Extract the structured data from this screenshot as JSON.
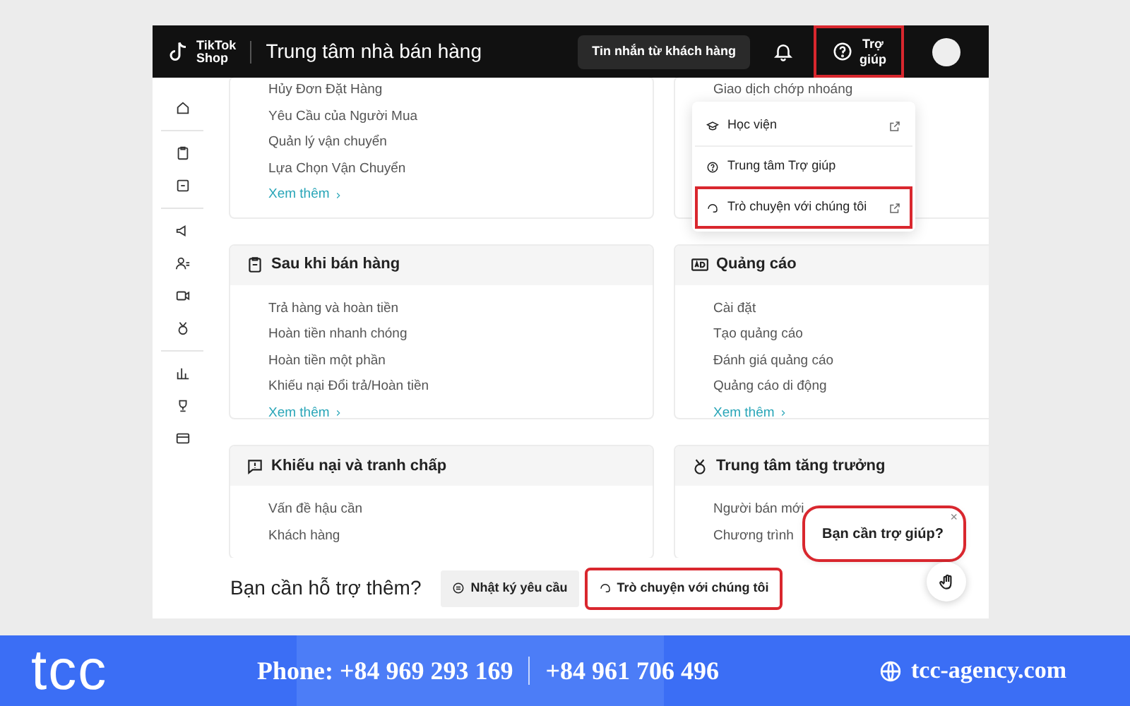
{
  "header": {
    "logo": [
      "TikTok",
      "Shop"
    ],
    "title": "Trung tâm nhà bán hàng",
    "messages_button": "Tin nhắn từ khách hàng",
    "help_button": {
      "label": [
        "Trợ",
        "giúp"
      ],
      "highlighted": true
    }
  },
  "help_menu": [
    {
      "label": "Học viện",
      "external": true,
      "highlighted": false
    },
    {
      "label": "Trung tâm Trợ giúp",
      "external": false,
      "highlighted": false
    },
    {
      "label": "Trò chuyện với chúng tôi",
      "external": true,
      "highlighted": true
    }
  ],
  "cards": [
    {
      "items": [
        "Hủy Đơn Đặt Hàng",
        "Yêu Cầu của Người Mua",
        "Quản lý vận chuyển",
        "Lựa Chọn Vận Chuyển"
      ],
      "more": "Xem thêm"
    },
    {
      "items": [
        "Giao dịch chớp nhoáng"
      ]
    },
    {
      "title": "Sau khi bán hàng",
      "items": [
        "Trả hàng và hoàn tiền",
        "Hoàn tiền nhanh chóng",
        "Hoàn tiền một phần",
        "Khiếu nại Đổi trả/Hoàn tiền"
      ],
      "more": "Xem thêm"
    },
    {
      "title": "Quảng cáo",
      "items": [
        "Cài đặt",
        "Tạo quảng cáo",
        "Đánh giá quảng cáo",
        "Quảng cáo di động"
      ],
      "more": "Xem thêm"
    },
    {
      "title": "Khiếu nại và tranh chấp",
      "items": [
        "Vấn đề hậu cần",
        "Khách hàng"
      ]
    },
    {
      "title": "Trung tâm tăng trưởng",
      "items": [
        "Người bán mới",
        "Chương trình"
      ]
    }
  ],
  "bottom_bar": {
    "prompt": "Bạn cần hỗ trợ thêm?",
    "buttons": [
      {
        "label": "Nhật ký yêu cầu",
        "highlighted": false
      },
      {
        "label": "Trò chuyện với chúng tôi",
        "highlighted": true
      }
    ]
  },
  "help_popup": {
    "text": "Bạn cần trợ giúp?",
    "close": "×",
    "highlighted": true
  },
  "banner": {
    "brand": "tcc",
    "phone": "Phone: +84 969 293 169",
    "phone_2": "+84 961 706 496",
    "website": "tcc-agency.com"
  }
}
